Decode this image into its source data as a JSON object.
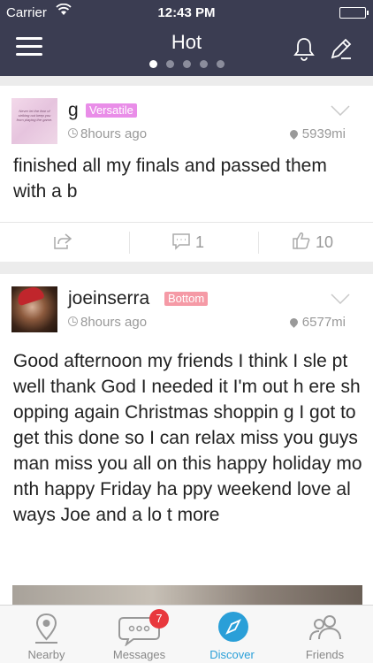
{
  "status": {
    "carrier": "Carrier",
    "time": "12:43 PM"
  },
  "header": {
    "title": "Hot",
    "page_count": 5,
    "active_page": 0
  },
  "posts": [
    {
      "avatar_text": "Never let the fear of striking out keep you from playing the game.",
      "username": "g",
      "badge": "Versatile",
      "time_ago": "8hours ago",
      "distance": "5939mi",
      "text": "finished all my finals and passed them with a b",
      "comments": "1",
      "likes": "10"
    },
    {
      "username": "joeinserra",
      "badge": "Bottom",
      "time_ago": "8hours ago",
      "distance": "6577mi",
      "text": "Good afternoon my friends I think I sle pt well thank God I needed it I'm out h ere shopping again Christmas shoppin g I got to get this done so I can relax miss you guys man miss you all on this  happy holiday month happy Friday ha ppy weekend love always Joe and a lo t more"
    }
  ],
  "tabs": [
    {
      "label": "Nearby",
      "icon": "location-pin-icon"
    },
    {
      "label": "Messages",
      "icon": "chat-bubble-icon",
      "badge": "7"
    },
    {
      "label": "Discover",
      "icon": "compass-icon",
      "active": true
    },
    {
      "label": "Friends",
      "icon": "friends-icon"
    }
  ],
  "colors": {
    "header_bg": "#3b3d52",
    "accent": "#2a9fd8",
    "badge_versatile": "#e98de8",
    "badge_bottom": "#f59aa6",
    "notification": "#e8383d"
  }
}
